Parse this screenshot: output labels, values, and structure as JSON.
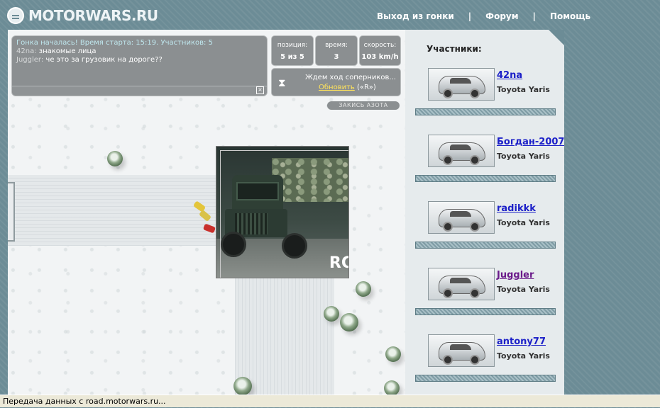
{
  "header": {
    "logo_text": "MOTORWARS.RU",
    "nav": [
      {
        "label": "Выход из гонки"
      },
      {
        "label": "Форум"
      },
      {
        "label": "Помощь"
      }
    ],
    "separator": "|"
  },
  "chat": {
    "system_message": "Гонка началась! Время старта: 15:19. Участников: 5",
    "messages": [
      {
        "author": "42na:",
        "text": "знакомые лица"
      },
      {
        "author": "Juggler:",
        "text": "че это за грузовик на дороге??"
      }
    ],
    "close_icon": "close-icon"
  },
  "stats": {
    "position": {
      "label": "позиция:",
      "value": "5 из 5"
    },
    "time": {
      "label": "время:",
      "value": "3"
    },
    "speed": {
      "label": "скорость:",
      "value": "103 km/h"
    }
  },
  "wait": {
    "text": "Ждем ход соперников...",
    "refresh_link": "Обновить",
    "hotkey": "(«R»)",
    "icon": "hourglass-icon"
  },
  "nitro_button": "ЗАКИСЬ АЗОТА",
  "popup": {
    "text": "RC"
  },
  "participants": {
    "title": "Участники:",
    "players": [
      {
        "name": "42na",
        "car": "Toyota Yaris",
        "visited": false
      },
      {
        "name": "Богдан-2007",
        "car": "Toyota Yaris",
        "visited": false
      },
      {
        "name": "radikkk",
        "car": "Toyota Yaris",
        "visited": false
      },
      {
        "name": "Juggler",
        "car": "Toyota Yaris",
        "visited": true
      },
      {
        "name": "antony77",
        "car": "Toyota Yaris",
        "visited": false
      }
    ]
  },
  "status_bar": "Передача данных с road.motorwars.ru..."
}
